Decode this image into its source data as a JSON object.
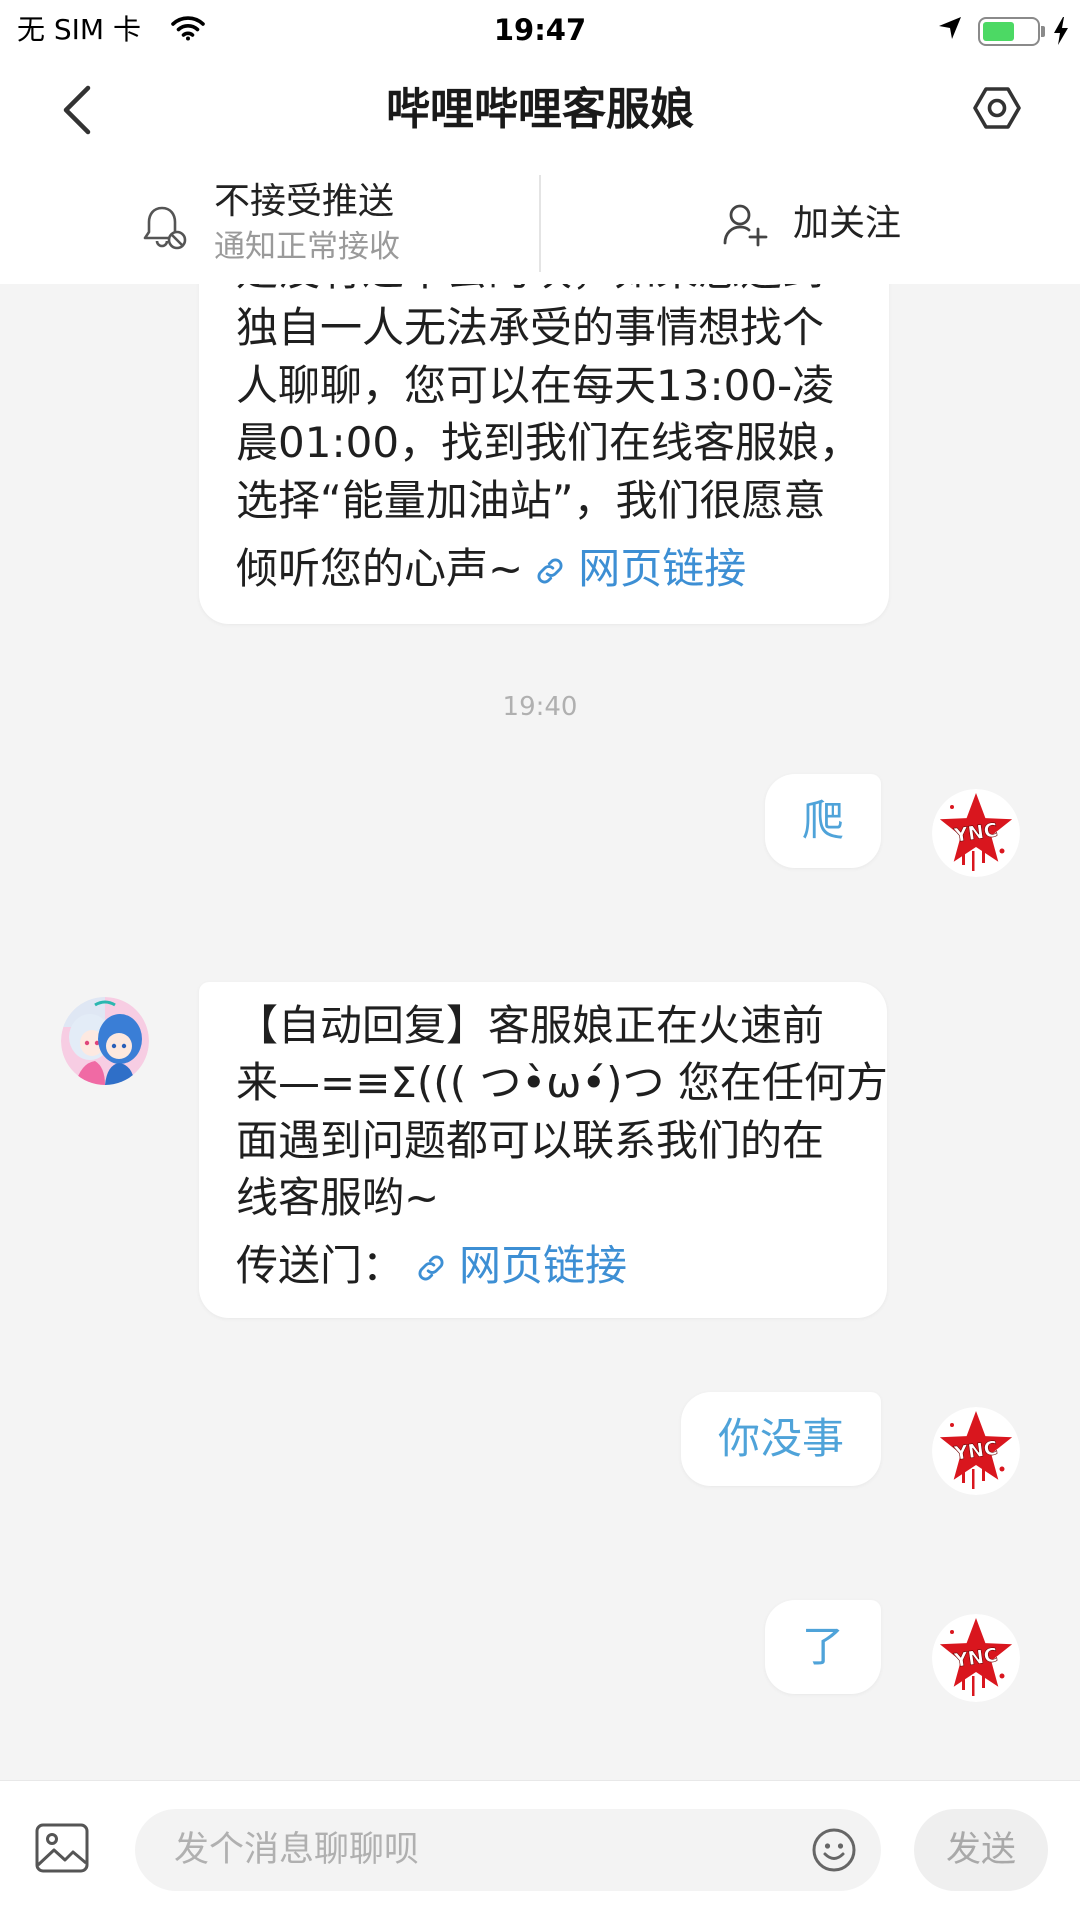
{
  "status_bar": {
    "carrier": "无 SIM 卡",
    "time": "19:47",
    "battery_level": 0.6,
    "icons": [
      "wifi-icon",
      "location-arrow-icon",
      "battery-icon",
      "charging-bolt-icon"
    ]
  },
  "nav": {
    "title": "哔哩哔哩客服娘",
    "back_icon": "chevron-left-icon",
    "settings_icon": "settings-icon"
  },
  "subscribe_bar": {
    "push": {
      "label": "不接受推送",
      "sublabel": "通知正常接收",
      "icon": "bell-off-icon"
    },
    "follow": {
      "label": "加关注",
      "icon": "user-plus-icon"
    }
  },
  "chat": [
    {
      "incoming": {
        "lines": [
          "是没有过不去的坎，如果您遇到",
          "独自一人无法承受的事情想找个",
          "人聊聊，您可以在每天13:00-凌",
          "晨01:00，找到我们在线客服娘，",
          "选择“能量加油站”，我们很愿意"
        ],
        "tail_text": "倾听您的心声~",
        "link_label": "网页链接"
      }
    },
    {
      "time": "19:40"
    },
    {
      "outgoing": "爬"
    },
    {
      "incoming": {
        "lines": [
          "【自动回复】客服娘正在火速前",
          "来—=≡Σ((( つ•̀ω•́)つ 您在任何方",
          "面遇到问题都可以联系我们的在",
          "线客服哟~"
        ],
        "tail_text": "传送门：",
        "link_label": "网页链接"
      }
    },
    {
      "outgoing": "你没事"
    },
    {
      "outgoing": "了"
    }
  ],
  "avatars": {
    "incoming": "bilibili-2233-avatar",
    "outgoing": "ync-star-avatar",
    "outgoing_logo_text": "YNC"
  },
  "composer": {
    "image_icon": "image-icon",
    "placeholder": "发个消息聊聊呗",
    "emoji_icon": "emoji-icon",
    "send_label": "发送"
  },
  "colors": {
    "chat_background": "#f4f4f4",
    "link": "#3d8fd4",
    "self_text": "#4fa3d9",
    "battery": "#4cd964"
  }
}
